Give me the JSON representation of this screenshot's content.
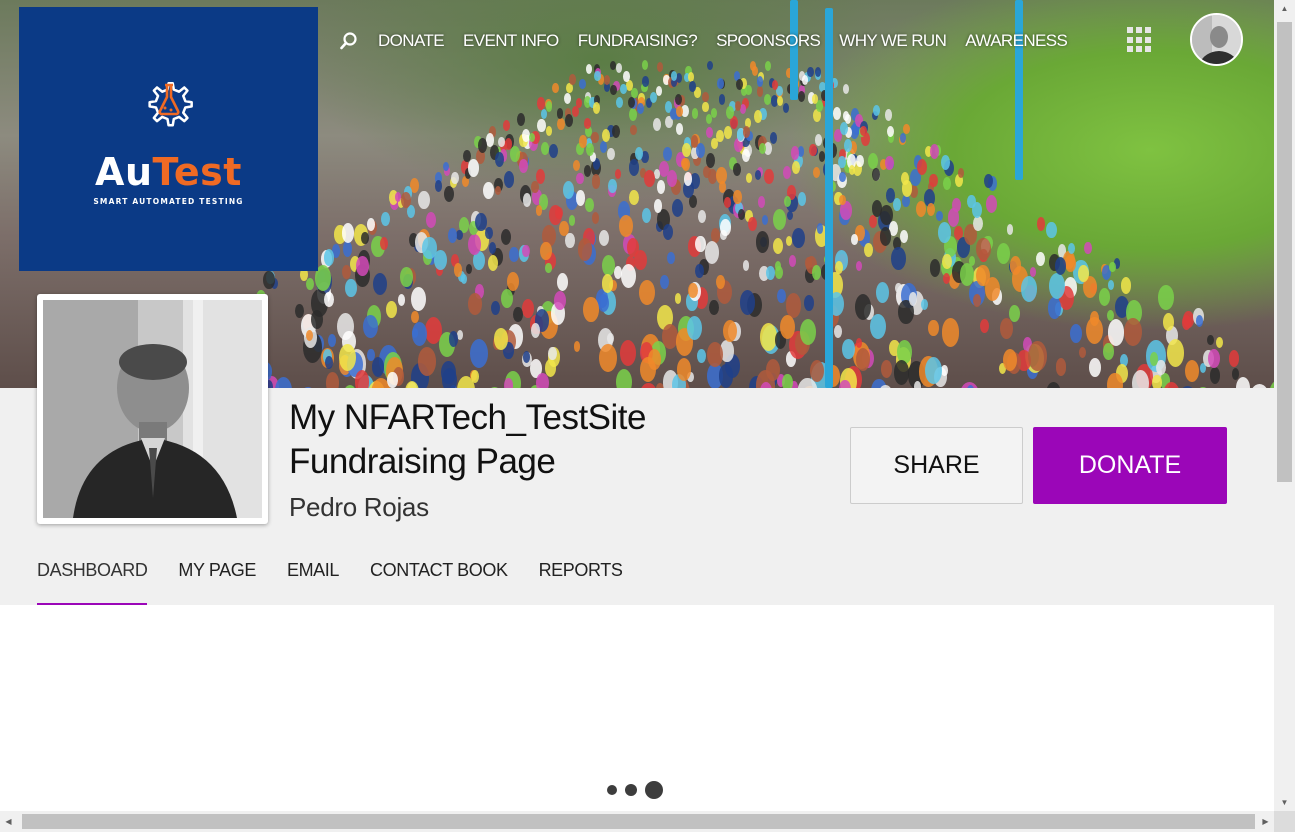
{
  "logo": {
    "brand_prefix": "Au",
    "brand_suffix": "Test",
    "tagline": "SMART AUTOMATED TESTING"
  },
  "topnav": {
    "search_icon": "search-icon",
    "items": [
      "DONATE",
      "EVENT INFO",
      "FUNDRAISING?",
      "SPOONSORS",
      "WHY WE RUN",
      "AWARENESS"
    ],
    "apps_icon": "grid-icon"
  },
  "profile": {
    "title": "My NFARTech_TestSite Fundraising Page",
    "owner_name": "Pedro Rojas"
  },
  "actions": {
    "share_label": "SHARE",
    "donate_label": "DONATE"
  },
  "tabs": [
    "DASHBOARD",
    "MY PAGE",
    "EMAIL",
    "CONTACT BOOK",
    "REPORTS"
  ],
  "active_tab": "DASHBOARD",
  "colors": {
    "accent": "#9b06b8",
    "logo_bg": "#0b3a86",
    "logo_accent": "#ef6a24",
    "band_bg": "#f0f0f0"
  }
}
